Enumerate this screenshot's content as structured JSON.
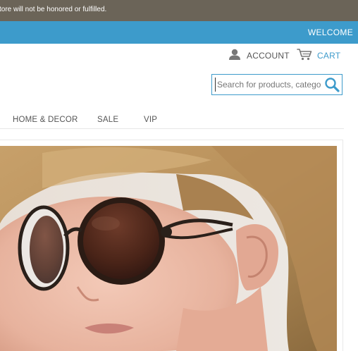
{
  "notice": {
    "text": "is store will not be honored or fulfilled."
  },
  "header": {
    "welcome_label": "WELCOME"
  },
  "account": {
    "label": "ACCOUNT",
    "icon": "user-icon"
  },
  "cart": {
    "label": "CART",
    "icon": "cart-icon"
  },
  "search": {
    "placeholder": "Search for products, catego",
    "icon": "search-icon"
  },
  "nav": {
    "items": [
      {
        "label": "HOME & DECOR"
      },
      {
        "label": "SALE"
      },
      {
        "label": "VIP"
      }
    ]
  },
  "hero": {
    "alt": "Woman wearing large round tortoiseshell sunglasses"
  },
  "colors": {
    "notice_bg": "#6b6458",
    "accent": "#3d9bcb",
    "text": "#555555"
  }
}
